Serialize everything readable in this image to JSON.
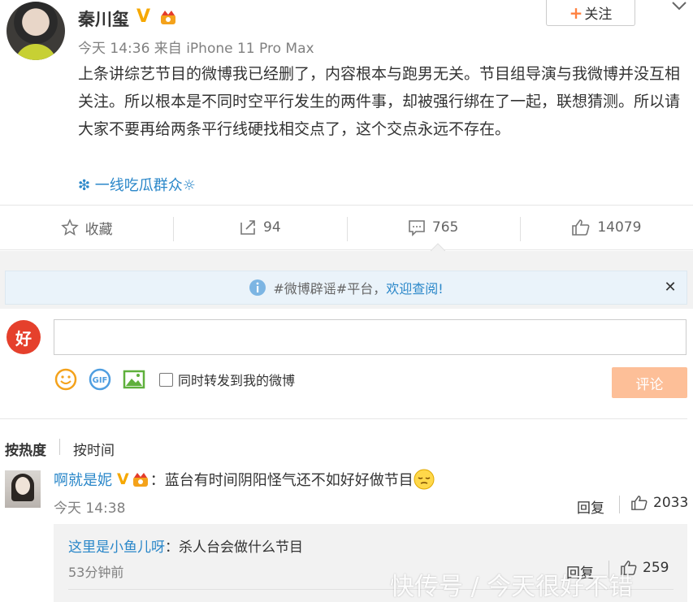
{
  "post": {
    "author": "秦川玺",
    "verified_badge": "V",
    "follow_label": "关注",
    "meta": "今天 14:36 来自 iPhone 11 Pro Max",
    "text": "上条讲综艺节目的微博我已经删了，内容根本与跑男无关。节目组导演与我微博并没互相关注。所以根本是不同时空平行发生的两件事，却被强行绑在了一起，联想猜测。所以请大家不要再给两条平行线硬找相交点了，这个交点永远不存在。",
    "topic": "❇ 一线吃瓜群众☼"
  },
  "actions": {
    "favorite_label": "收藏",
    "repost_count": "94",
    "comment_count": "765",
    "like_count": "14079"
  },
  "notice": {
    "prefix": "#微博辟谣#平台，",
    "link": "欢迎查阅!"
  },
  "composer": {
    "avatar_text": "好",
    "input_value": "",
    "repost_label": "同时转发到我的微博",
    "submit_label": "评论"
  },
  "sort": {
    "hot_label": "按热度",
    "time_label": "按时间"
  },
  "comment": {
    "user": "啊就是妮",
    "verified_badge": "V",
    "text": "：蓝台有时间阴阳怪气还不如好好做节目",
    "time": "今天 14:38",
    "reply_label": "回复",
    "likes": "2033"
  },
  "sub_comment": {
    "user": "这里是小鱼儿呀",
    "text": "：杀人台会做什么节目",
    "time": "53分钟前",
    "reply_label": "回复",
    "likes": "259"
  },
  "watermark": "快传号 / 今天很好不错",
  "colors": {
    "link": "#2a87c9",
    "orange": "#ff8140",
    "submit_bg": "#fdbf98",
    "badge": "#f6a800"
  }
}
